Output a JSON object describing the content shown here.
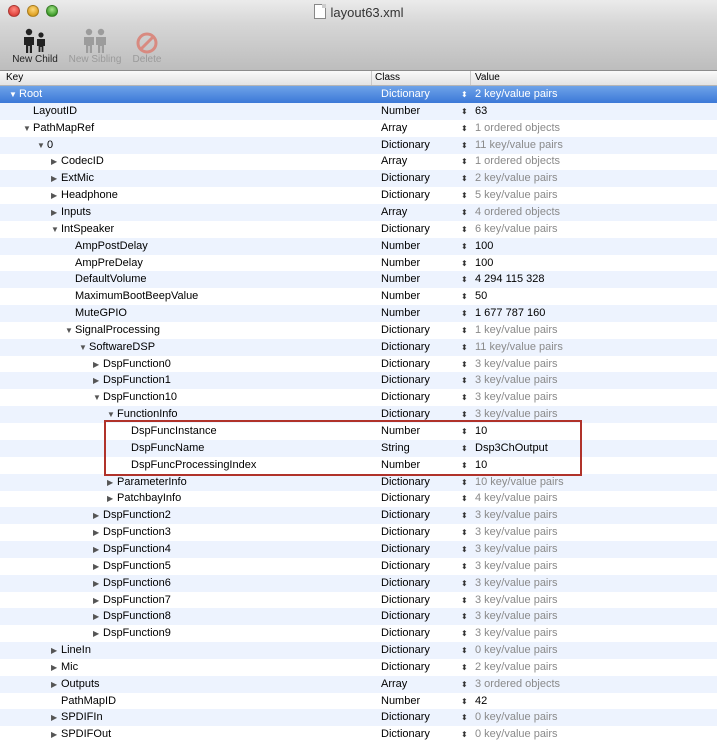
{
  "window": {
    "title": "layout63.xml"
  },
  "toolbar": {
    "new_child": "New Child",
    "new_sibling": "New Sibling",
    "delete": "Delete"
  },
  "columns": {
    "key": "Key",
    "class": "Class",
    "value": "Value"
  },
  "rows": [
    {
      "key": "Root",
      "class": "Dictionary",
      "value": "2 key/value pairs",
      "depth": 0,
      "expand": "open",
      "dim": false,
      "selected": true
    },
    {
      "key": "LayoutID",
      "class": "Number",
      "value": "63",
      "depth": 1,
      "expand": "none",
      "dim": false
    },
    {
      "key": "PathMapRef",
      "class": "Array",
      "value": "1 ordered objects",
      "depth": 1,
      "expand": "open",
      "dim": true
    },
    {
      "key": "0",
      "class": "Dictionary",
      "value": "11 key/value pairs",
      "depth": 2,
      "expand": "open",
      "dim": true
    },
    {
      "key": "CodecID",
      "class": "Array",
      "value": "1 ordered objects",
      "depth": 3,
      "expand": "closed",
      "dim": true
    },
    {
      "key": "ExtMic",
      "class": "Dictionary",
      "value": "2 key/value pairs",
      "depth": 3,
      "expand": "closed",
      "dim": true
    },
    {
      "key": "Headphone",
      "class": "Dictionary",
      "value": "5 key/value pairs",
      "depth": 3,
      "expand": "closed",
      "dim": true
    },
    {
      "key": "Inputs",
      "class": "Array",
      "value": "4 ordered objects",
      "depth": 3,
      "expand": "closed",
      "dim": true
    },
    {
      "key": "IntSpeaker",
      "class": "Dictionary",
      "value": "6 key/value pairs",
      "depth": 3,
      "expand": "open",
      "dim": true
    },
    {
      "key": "AmpPostDelay",
      "class": "Number",
      "value": "100",
      "depth": 4,
      "expand": "none",
      "dim": false
    },
    {
      "key": "AmpPreDelay",
      "class": "Number",
      "value": "100",
      "depth": 4,
      "expand": "none",
      "dim": false
    },
    {
      "key": "DefaultVolume",
      "class": "Number",
      "value": "4 294 115 328",
      "depth": 4,
      "expand": "none",
      "dim": false
    },
    {
      "key": "MaximumBootBeepValue",
      "class": "Number",
      "value": "50",
      "depth": 4,
      "expand": "none",
      "dim": false
    },
    {
      "key": "MuteGPIO",
      "class": "Number",
      "value": "1 677 787 160",
      "depth": 4,
      "expand": "none",
      "dim": false
    },
    {
      "key": "SignalProcessing",
      "class": "Dictionary",
      "value": "1 key/value pairs",
      "depth": 4,
      "expand": "open",
      "dim": true
    },
    {
      "key": "SoftwareDSP",
      "class": "Dictionary",
      "value": "11 key/value pairs",
      "depth": 5,
      "expand": "open",
      "dim": true
    },
    {
      "key": "DspFunction0",
      "class": "Dictionary",
      "value": "3 key/value pairs",
      "depth": 6,
      "expand": "closed",
      "dim": true
    },
    {
      "key": "DspFunction1",
      "class": "Dictionary",
      "value": "3 key/value pairs",
      "depth": 6,
      "expand": "closed",
      "dim": true
    },
    {
      "key": "DspFunction10",
      "class": "Dictionary",
      "value": "3 key/value pairs",
      "depth": 6,
      "expand": "open",
      "dim": true
    },
    {
      "key": "FunctionInfo",
      "class": "Dictionary",
      "value": "3 key/value pairs",
      "depth": 7,
      "expand": "open",
      "dim": true
    },
    {
      "key": "DspFuncInstance",
      "class": "Number",
      "value": "10",
      "depth": 8,
      "expand": "none",
      "dim": false
    },
    {
      "key": "DspFuncName",
      "class": "String",
      "value": "Dsp3ChOutput",
      "depth": 8,
      "expand": "none",
      "dim": false
    },
    {
      "key": "DspFuncProcessingIndex",
      "class": "Number",
      "value": "10",
      "depth": 8,
      "expand": "none",
      "dim": false
    },
    {
      "key": "ParameterInfo",
      "class": "Dictionary",
      "value": "10 key/value pairs",
      "depth": 7,
      "expand": "closed",
      "dim": true
    },
    {
      "key": "PatchbayInfo",
      "class": "Dictionary",
      "value": "4 key/value pairs",
      "depth": 7,
      "expand": "closed",
      "dim": true
    },
    {
      "key": "DspFunction2",
      "class": "Dictionary",
      "value": "3 key/value pairs",
      "depth": 6,
      "expand": "closed",
      "dim": true
    },
    {
      "key": "DspFunction3",
      "class": "Dictionary",
      "value": "3 key/value pairs",
      "depth": 6,
      "expand": "closed",
      "dim": true
    },
    {
      "key": "DspFunction4",
      "class": "Dictionary",
      "value": "3 key/value pairs",
      "depth": 6,
      "expand": "closed",
      "dim": true
    },
    {
      "key": "DspFunction5",
      "class": "Dictionary",
      "value": "3 key/value pairs",
      "depth": 6,
      "expand": "closed",
      "dim": true
    },
    {
      "key": "DspFunction6",
      "class": "Dictionary",
      "value": "3 key/value pairs",
      "depth": 6,
      "expand": "closed",
      "dim": true
    },
    {
      "key": "DspFunction7",
      "class": "Dictionary",
      "value": "3 key/value pairs",
      "depth": 6,
      "expand": "closed",
      "dim": true
    },
    {
      "key": "DspFunction8",
      "class": "Dictionary",
      "value": "3 key/value pairs",
      "depth": 6,
      "expand": "closed",
      "dim": true
    },
    {
      "key": "DspFunction9",
      "class": "Dictionary",
      "value": "3 key/value pairs",
      "depth": 6,
      "expand": "closed",
      "dim": true
    },
    {
      "key": "LineIn",
      "class": "Dictionary",
      "value": "0 key/value pairs",
      "depth": 3,
      "expand": "closed",
      "dim": true
    },
    {
      "key": "Mic",
      "class": "Dictionary",
      "value": "2 key/value pairs",
      "depth": 3,
      "expand": "closed",
      "dim": true
    },
    {
      "key": "Outputs",
      "class": "Array",
      "value": "3 ordered objects",
      "depth": 3,
      "expand": "closed",
      "dim": true
    },
    {
      "key": "PathMapID",
      "class": "Number",
      "value": "42",
      "depth": 3,
      "expand": "none",
      "dim": false
    },
    {
      "key": "SPDIFIn",
      "class": "Dictionary",
      "value": "0 key/value pairs",
      "depth": 3,
      "expand": "closed",
      "dim": true
    },
    {
      "key": "SPDIFOut",
      "class": "Dictionary",
      "value": "0 key/value pairs",
      "depth": 3,
      "expand": "closed",
      "dim": true
    }
  ]
}
